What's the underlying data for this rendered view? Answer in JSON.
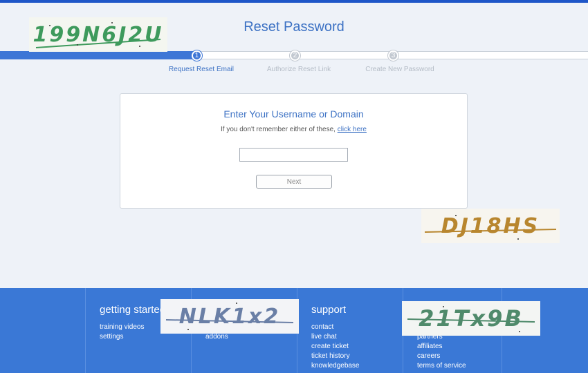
{
  "header": {
    "title": "Reset Password"
  },
  "captchas": [
    {
      "text": "199N6J2U",
      "color": "#3e9a5c"
    },
    {
      "text": "DJ18HS",
      "color": "#b8862e"
    },
    {
      "text": "NLK1x2",
      "color": "#6a7fa6"
    },
    {
      "text": "21Tx9B",
      "color": "#4f8a6b"
    }
  ],
  "steps": [
    {
      "number": "1",
      "label": "Request Reset Email",
      "state": "active"
    },
    {
      "number": "2",
      "label": "Authorize Reset Link",
      "state": "pending"
    },
    {
      "number": "3",
      "label": "Create New Password",
      "state": "pending"
    }
  ],
  "form": {
    "title": "Enter Your Username or Domain",
    "hint": "If you don't remember either of these,",
    "hint_link": "click here",
    "input_value": "",
    "next_label": "Next"
  },
  "footer": {
    "columns": [
      {
        "heading": "getting started",
        "links": [
          "training videos",
          "settings"
        ]
      },
      {
        "heading": "",
        "links": [
          "addons"
        ]
      },
      {
        "heading": "support",
        "links": [
          "contact",
          "live chat",
          "create ticket",
          "ticket history",
          "knowledgebase"
        ]
      },
      {
        "heading": "",
        "links": [
          "partners",
          "affiliates",
          "careers",
          "terms of service"
        ]
      }
    ]
  },
  "colors": {
    "accent": "#3d72c4",
    "footer_bg": "#3a78d6",
    "page_bg": "#eef2f8"
  }
}
